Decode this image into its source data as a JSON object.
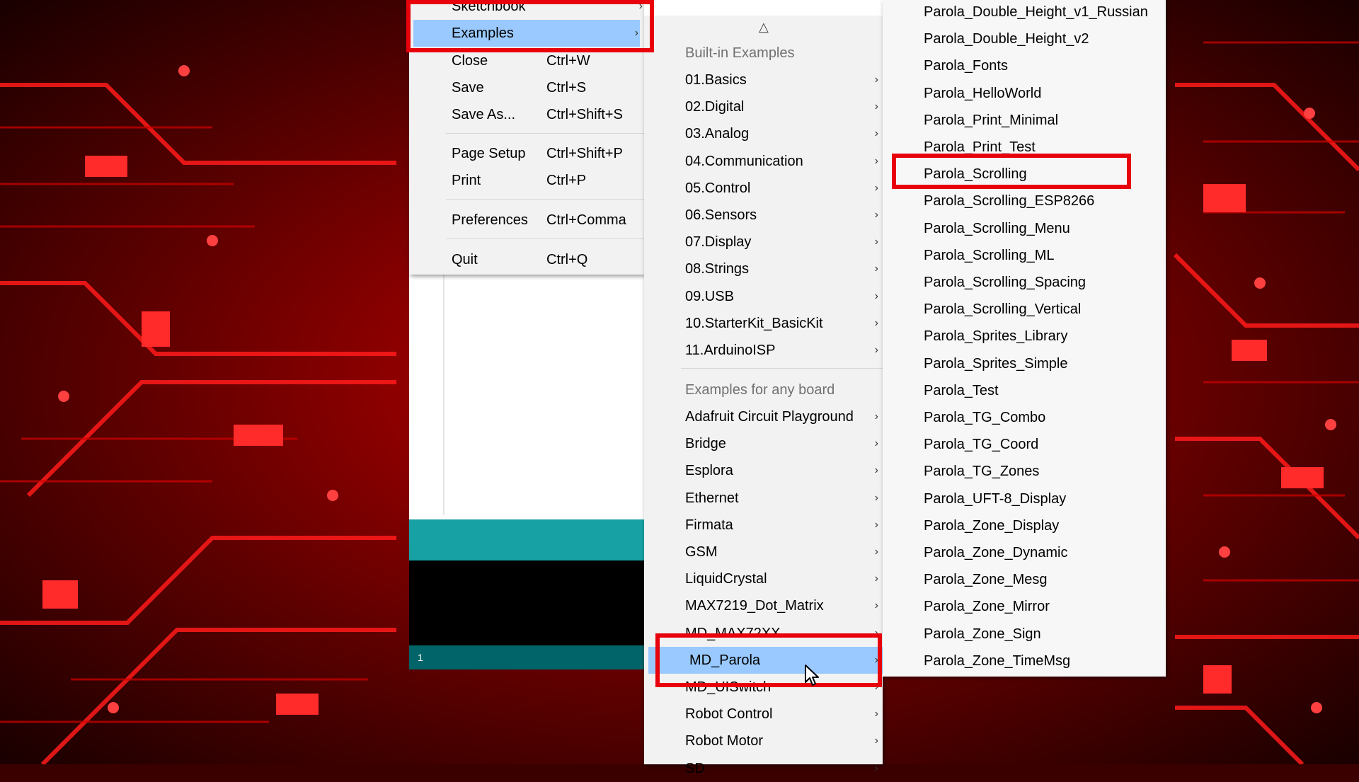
{
  "file_menu": {
    "items": [
      {
        "label": "Sketchbook",
        "shortcut": "",
        "arrow": "›"
      },
      {
        "label": "Examples",
        "shortcut": "",
        "arrow": "›"
      },
      {
        "label": "Close",
        "shortcut": "Ctrl+W"
      },
      {
        "label": "Save",
        "shortcut": "Ctrl+S"
      },
      {
        "label": "Save As...",
        "shortcut": "Ctrl+Shift+S"
      },
      {
        "label": "Page Setup",
        "shortcut": "Ctrl+Shift+P"
      },
      {
        "label": "Print",
        "shortcut": "Ctrl+P"
      },
      {
        "label": "Preferences",
        "shortcut": "Ctrl+Comma"
      },
      {
        "label": "Quit",
        "shortcut": "Ctrl+Q"
      }
    ],
    "highlighted": "Examples"
  },
  "examples_menu": {
    "scroll_up_icon": "△",
    "builtin_header": "Built-in Examples",
    "builtin": [
      "01.Basics",
      "02.Digital",
      "03.Analog",
      "04.Communication",
      "05.Control",
      "06.Sensors",
      "07.Display",
      "08.Strings",
      "09.USB",
      "10.StarterKit_BasicKit",
      "11.ArduinoISP"
    ],
    "anyboard_header": "Examples for any board",
    "anyboard": [
      "Adafruit Circuit Playground",
      "Bridge",
      "Esplora",
      "Ethernet",
      "Firmata",
      "GSM",
      "LiquidCrystal",
      "MAX7219_Dot_Matrix",
      "MD_MAX72XX",
      "MD_Parola",
      "MD_UISwitch",
      "Robot Control",
      "Robot Motor",
      "SD"
    ],
    "arrow": "›",
    "highlighted": "MD_Parola"
  },
  "parola_menu": {
    "items": [
      "Parola_Double_Height_v1_Russian",
      "Parola_Double_Height_v2",
      "Parola_Fonts",
      "Parola_HelloWorld",
      "Parola_Print_Minimal",
      "Parola_Print_Test",
      "Parola_Scrolling",
      "Parola_Scrolling_ESP8266",
      "Parola_Scrolling_Menu",
      "Parola_Scrolling_ML",
      "Parola_Scrolling_Spacing",
      "Parola_Scrolling_Vertical",
      "Parola_Sprites_Library",
      "Parola_Sprites_Simple",
      "Parola_Test",
      "Parola_TG_Combo",
      "Parola_TG_Coord",
      "Parola_TG_Zones",
      "Parola_UFT-8_Display",
      "Parola_Zone_Display",
      "Parola_Zone_Dynamic",
      "Parola_Zone_Mesg",
      "Parola_Zone_Mirror",
      "Parola_Zone_Sign",
      "Parola_Zone_TimeMsg"
    ],
    "boxed": "Parola_Scrolling"
  },
  "ide": {
    "line_number": "1"
  },
  "colors": {
    "highlight": "#99c9ff",
    "annotation": "#e8000b",
    "menu_bg": "#f2f2f2",
    "teal": "#17a1a5",
    "status": "#006468"
  }
}
